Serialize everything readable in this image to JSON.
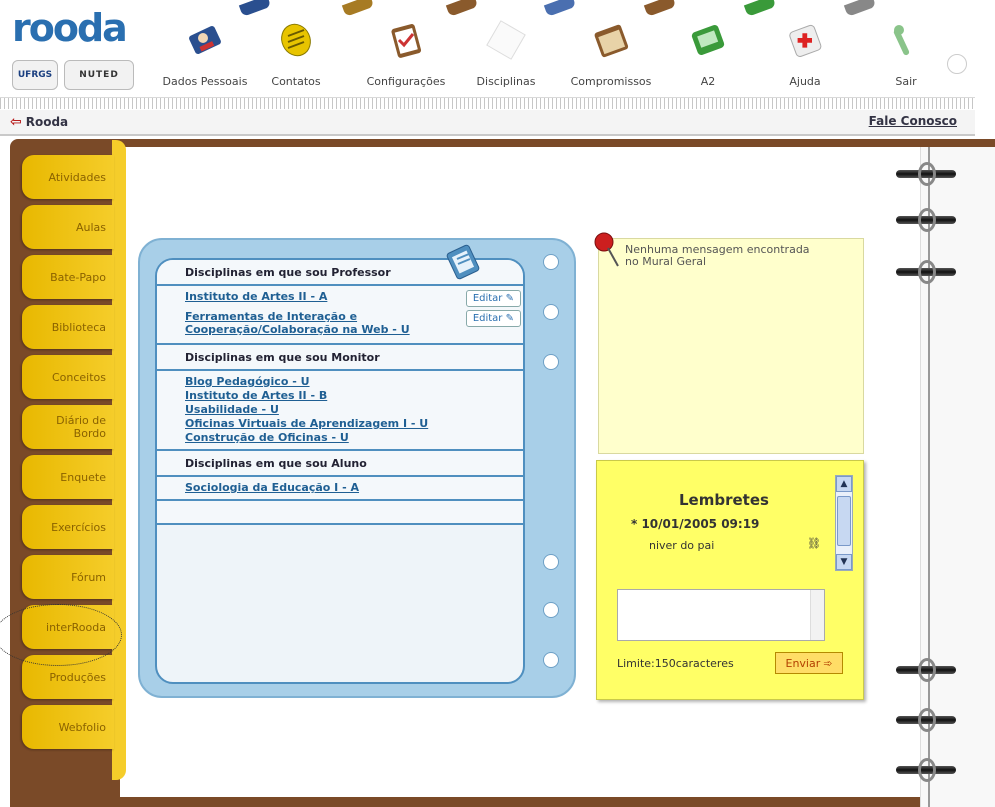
{
  "app": {
    "logo_text": "rooda",
    "badge_left": "UFRGS",
    "badge_right": "NUTED"
  },
  "toolbar": {
    "items": [
      {
        "label": "Dados Pessoais",
        "icon": "user-card-icon"
      },
      {
        "label": "Contatos",
        "icon": "notepad-icon"
      },
      {
        "label": "Configurações",
        "icon": "checklist-icon"
      },
      {
        "label": "Disciplinas",
        "icon": "blank-page-icon"
      },
      {
        "label": "Compromissos",
        "icon": "calendar-icon"
      },
      {
        "label": "A2",
        "icon": "screen-icon"
      },
      {
        "label": "Ajuda",
        "icon": "help-cross-icon"
      },
      {
        "label": "Sair",
        "icon": "exit-icon"
      }
    ]
  },
  "breadcrumb": {
    "back_label": "Rooda",
    "contact_label": "Fale Conosco"
  },
  "tabs": [
    "Atividades",
    "Aulas",
    "Bate-Papo",
    "Biblioteca",
    "Conceitos",
    "Diário de Bordo",
    "Enquete",
    "Exercícios",
    "Fórum",
    "interRooda",
    "Produções",
    "Webfolio"
  ],
  "disciplines": {
    "professor_title": "Disciplinas em que sou Professor",
    "professor_items": [
      {
        "name": "Instituto de Artes II - A",
        "edit": "Editar"
      },
      {
        "name": "Ferramentas de Interação e Cooperação/Colaboração na Web - U",
        "edit": "Editar"
      }
    ],
    "monitor_title": "Disciplinas em que sou Monitor",
    "monitor_items": [
      "Blog Pedagógico - U",
      "Instituto de Artes II - B",
      "Usabilidade - U",
      "Oficinas Virtuais de Aprendizagem I - U",
      "Construção de Oficinas - U"
    ],
    "student_title": "Disciplinas em que sou Aluno",
    "student_items": [
      "Sociologia da Educação I - A"
    ]
  },
  "mural": {
    "message": "Nenhuma mensagem encontrada no Mural Geral"
  },
  "lembretes": {
    "title": "Lembretes",
    "date": "* 10/01/2005 09:19",
    "text": "niver do pai",
    "input_value": "",
    "limit": "Limite:150caracteres",
    "send_label": "Enviar"
  },
  "colors": {
    "tab_yellow": "#f5cd2a",
    "card_blue": "#a8cfe8",
    "link_blue": "#1f5f93",
    "binder_brown": "#7a4a28",
    "note_yellow": "#ffff66"
  }
}
